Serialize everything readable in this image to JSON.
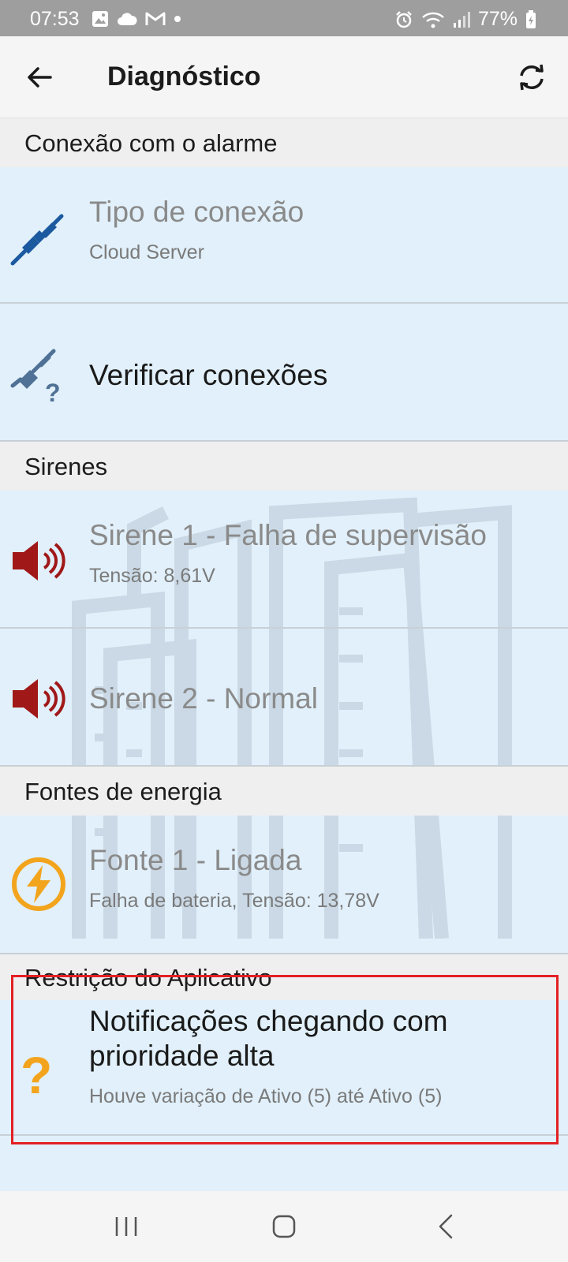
{
  "status_bar": {
    "time": "07:53",
    "battery": "77%",
    "notification_icons": [
      "gallery-icon",
      "cloud-icon",
      "gmail-icon",
      "dot-icon"
    ],
    "system_icons": [
      "alarm-icon",
      "wifi-icon",
      "signal-icon",
      "battery-charging-icon"
    ]
  },
  "app_bar": {
    "title": "Diagnóstico"
  },
  "sections": {
    "connection": {
      "header": "Conexão com o alarme",
      "items": [
        {
          "title": "Tipo de conexão",
          "subtitle": "Cloud Server",
          "icon": "plug-connected-icon"
        },
        {
          "title": "Verificar conexões",
          "icon": "plug-question-icon"
        }
      ]
    },
    "sirens": {
      "header": "Sirenes",
      "items": [
        {
          "title": "Sirene 1 - Falha de supervisão",
          "subtitle": "Tensão: 8,61V",
          "icon": "speaker-icon"
        },
        {
          "title": "Sirene 2 - Normal",
          "icon": "speaker-icon"
        }
      ]
    },
    "power": {
      "header": "Fontes de energia",
      "items": [
        {
          "title": "Fonte 1 - Ligada",
          "subtitle": "Falha de bateria, Tensão: 13,78V",
          "icon": "lightning-icon"
        }
      ]
    },
    "restriction": {
      "header": "Restrição do Aplicativo",
      "items": [
        {
          "title_line1": "Notificações chegando com",
          "title_line2": "prioridade alta",
          "subtitle": "Houve variação de Ativo (5) até Ativo (5)",
          "icon": "question-mark-icon"
        }
      ]
    }
  },
  "colors": {
    "status_bar": "#9e9e9e",
    "list_background": "#e1f0fa",
    "section_header": "#efefef",
    "plug_blue": "#1c5aa0",
    "siren_red": "#a01818",
    "lightning_amber": "#f3a41d",
    "highlight_border": "#e32024"
  },
  "nav_bar": {
    "icons": [
      "recent-apps-icon",
      "home-icon",
      "back-nav-icon"
    ]
  }
}
